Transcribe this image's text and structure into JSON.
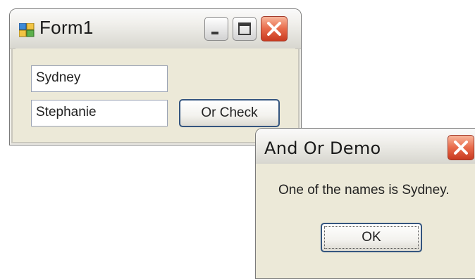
{
  "form1": {
    "title": "Form1",
    "textbox1_value": "Sydney",
    "textbox2_value": "Stephanie",
    "button_label": "Or Check"
  },
  "msgbox": {
    "title": "And Or Demo",
    "message": "One of the names is Sydney.",
    "ok_label": "OK"
  },
  "colors": {
    "window_bg": "#ece9d8",
    "close_red": "#e0502f",
    "button_border": "#34557f"
  },
  "icons": {
    "form1_app": "app-form-icon",
    "minimize": "minimize-icon",
    "maximize": "maximize-icon",
    "close": "close-icon"
  }
}
